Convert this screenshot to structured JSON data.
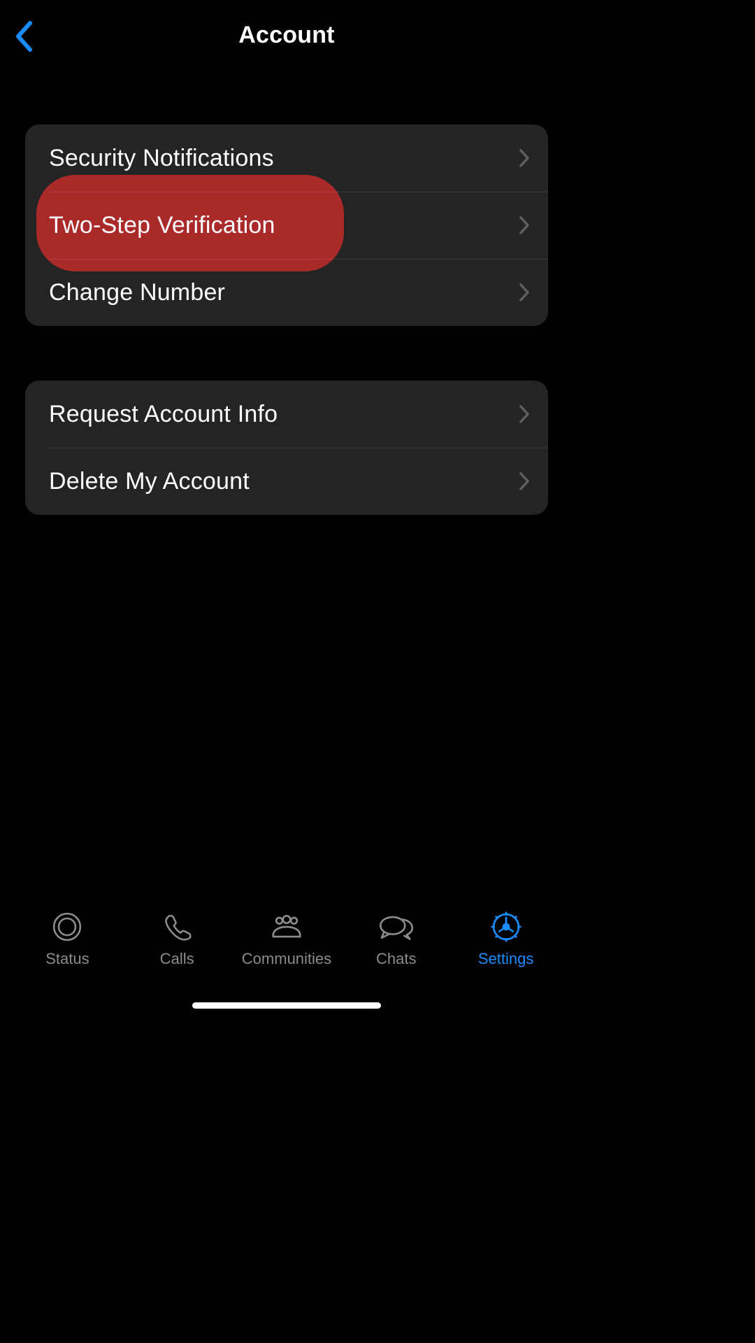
{
  "header": {
    "title": "Account"
  },
  "groups": [
    {
      "rows": [
        {
          "label": "Security Notifications"
        },
        {
          "label": "Two-Step Verification"
        },
        {
          "label": "Change Number"
        }
      ]
    },
    {
      "rows": [
        {
          "label": "Request Account Info"
        },
        {
          "label": "Delete My Account"
        }
      ]
    }
  ],
  "tabs": {
    "status": "Status",
    "calls": "Calls",
    "communities": "Communities",
    "chats": "Chats",
    "settings": "Settings"
  },
  "colors": {
    "accent": "#1b8cff",
    "highlight": "#A92A28",
    "group_bg": "#242424"
  }
}
